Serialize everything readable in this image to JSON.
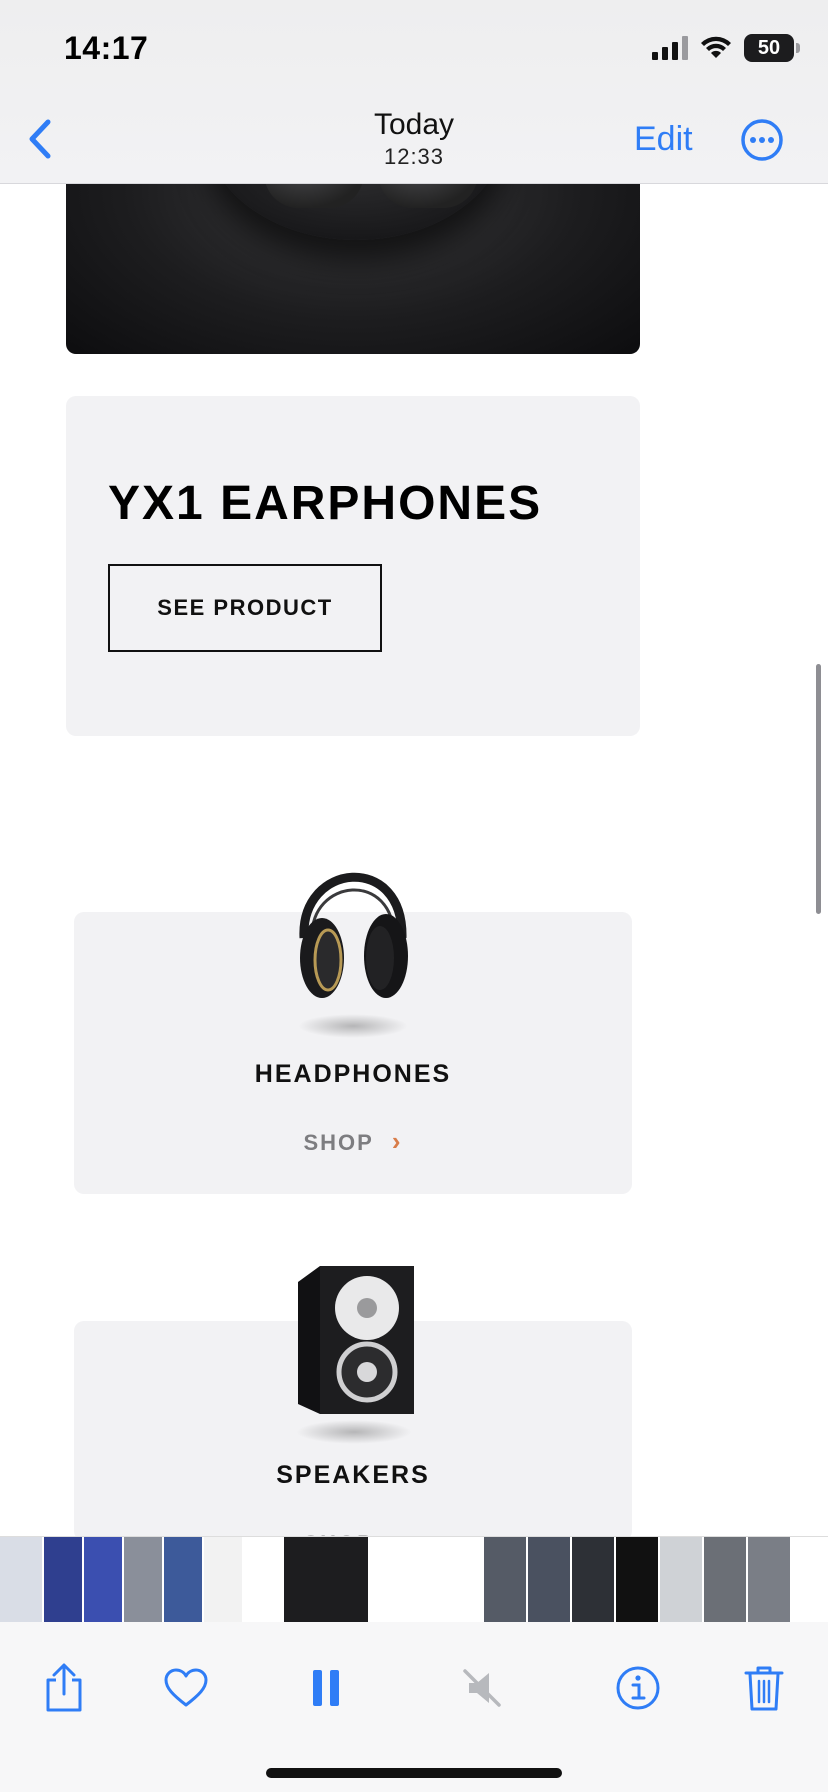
{
  "status_bar": {
    "time": "14:17",
    "battery": "50"
  },
  "nav": {
    "title": "Today",
    "subtitle": "12:33",
    "edit_label": "Edit"
  },
  "page": {
    "featured": {
      "title": "YX1 EARPHONES",
      "button_label": "SEE PRODUCT"
    },
    "categories": [
      {
        "title": "HEADPHONES",
        "link_label": "SHOP",
        "chevron": "›"
      },
      {
        "title": "SPEAKERS",
        "link_label": "SHOP",
        "chevron": "›"
      }
    ]
  },
  "thumbnail_strip": {
    "thumb_colors": [
      "#d9dde6",
      "#2f3f8f",
      "#3b4fb0",
      "#8a8f9a",
      "#3d5a9a",
      "#f2f2f2",
      "#ffffff",
      "#1d1d1f",
      "#ffffff",
      "#ffffff",
      "#555b66",
      "#4a5160",
      "#2d3036",
      "#111111",
      "#cfd2d6",
      "#6b6f76",
      "#7a7e86"
    ],
    "thumb_widths": [
      42,
      38,
      38,
      38,
      38,
      38,
      38,
      84,
      4,
      106,
      42,
      42,
      42,
      42,
      42,
      42,
      42
    ]
  },
  "toolbar": {
    "icons": [
      "share-icon",
      "heart-icon",
      "pause-icon",
      "mute-icon",
      "info-icon",
      "trash-icon"
    ],
    "accent_color": "#2f7df6"
  },
  "colors": {
    "accent": "#2f7df6",
    "card_bg": "#f2f2f4",
    "shop_chevron": "#d87d4a"
  }
}
